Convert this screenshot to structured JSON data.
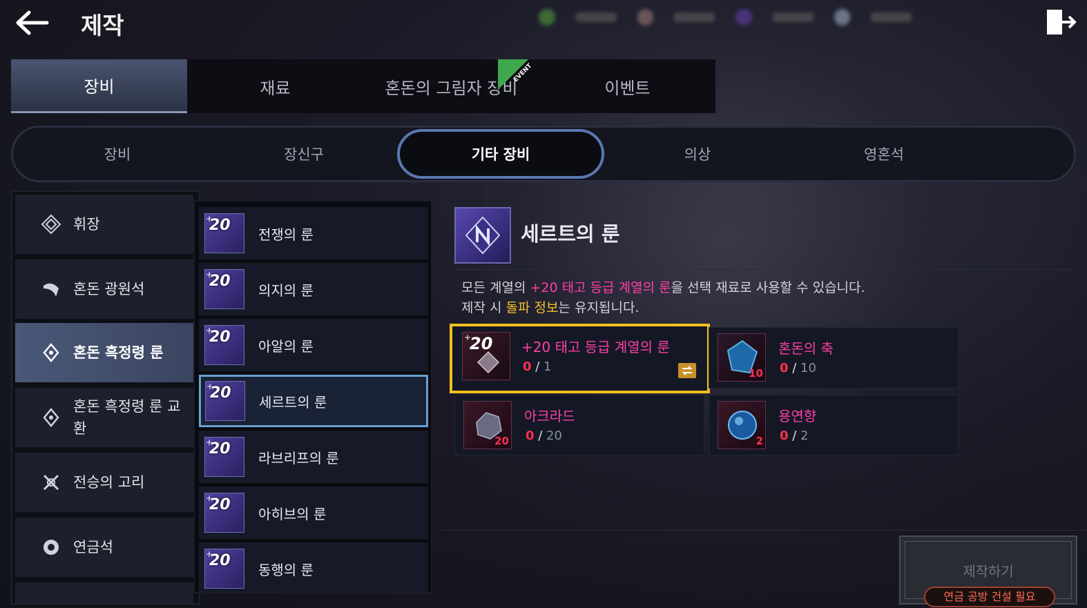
{
  "header": {
    "title": "제작",
    "back_icon": "arrow-left-icon",
    "exit_icon": "exit-door-icon"
  },
  "main_tabs": [
    {
      "label": "장비",
      "active": true
    },
    {
      "label": "재료",
      "active": false
    },
    {
      "label": "혼돈의 그림자 장비",
      "active": false,
      "badge": "EVENT"
    },
    {
      "label": "이벤트",
      "active": false
    }
  ],
  "sub_tabs": [
    {
      "label": "장비",
      "active": false
    },
    {
      "label": "장신구",
      "active": false
    },
    {
      "label": "기타 장비",
      "active": true
    },
    {
      "label": "의상",
      "active": false
    },
    {
      "label": "영혼석",
      "active": false
    }
  ],
  "categories": [
    {
      "label": "휘장",
      "icon": "emblem-icon",
      "active": false
    },
    {
      "label": "혼돈 광원석",
      "icon": "crescent-stone-icon",
      "active": false
    },
    {
      "label": "혼돈 흑정령 룬",
      "icon": "rune-diamond-icon",
      "active": true
    },
    {
      "label": "혼돈 흑정령 룬 교환",
      "icon": "rune-diamond-icon",
      "active": false
    },
    {
      "label": "전승의 고리",
      "icon": "crossed-ring-icon",
      "active": false
    },
    {
      "label": "연금석",
      "icon": "alchemy-stone-icon",
      "active": false
    }
  ],
  "runes": [
    {
      "label": "전쟁의 룬",
      "level": "20",
      "active": false
    },
    {
      "label": "의지의 룬",
      "level": "20",
      "active": false
    },
    {
      "label": "아알의 룬",
      "level": "20",
      "active": false
    },
    {
      "label": "세르트의 룬",
      "level": "20",
      "active": true
    },
    {
      "label": "라브리프의 룬",
      "level": "20",
      "active": false
    },
    {
      "label": "아히브의 룬",
      "level": "20",
      "active": false
    },
    {
      "label": "동행의 룬",
      "level": "20",
      "active": false
    }
  ],
  "detail": {
    "title": "세르트의 룬",
    "desc1_a": "모든 계열의 ",
    "desc1_b": "+20 태고 등급 계열의 룬",
    "desc1_c": "을 선택 재료로 사용할 수 있습니다.",
    "desc2_a": "제작 시 ",
    "desc2_b": "돌파 정보",
    "desc2_c": "는 유지됩니다."
  },
  "materials": [
    {
      "name": "+20 태고 등급 계열의 룬",
      "have": "0",
      "need": "1",
      "icon_count": "",
      "icon": "rune-icon",
      "selected": true,
      "swap_icon": "swap-arrows-icon"
    },
    {
      "name": "혼돈의 축",
      "have": "0",
      "need": "10",
      "icon_count": "10",
      "icon": "blue-crystal-icon",
      "selected": false
    },
    {
      "name": "아크라드",
      "have": "0",
      "need": "20",
      "icon_count": "20",
      "icon": "ore-icon",
      "selected": false
    },
    {
      "name": "용연향",
      "have": "0",
      "need": "2",
      "icon_count": "2",
      "icon": "blue-orb-icon",
      "selected": false
    }
  ],
  "craft": {
    "label": "제작하기",
    "requirement": "연금 공방 건설 필요",
    "enabled": false
  },
  "colors": {
    "accent_pink": "#ff3fa6",
    "accent_yellow": "#f4c030",
    "selected_border": "#f0c020",
    "active_sub_tab_border": "#5a78b0",
    "event_ribbon": "#3fa84c"
  }
}
